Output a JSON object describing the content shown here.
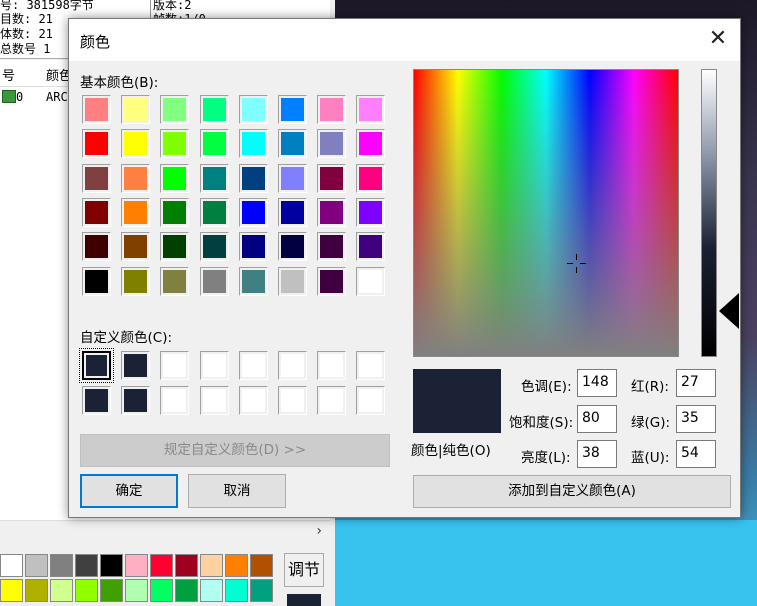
{
  "background": {
    "info_lines": [
      "号: 381598字节",
      "目数: 21",
      "体数: 21",
      "总数号 1"
    ],
    "info_right": [
      "版本:2",
      "帧数:1/0"
    ],
    "list_headers": [
      "号",
      "颜色"
    ],
    "list_row": {
      "index": "0",
      "value": "ARC"
    },
    "scroll_arrow": "›",
    "palette_colors": [
      "#ffffff",
      "#c0c0c0",
      "#808080",
      "#404040",
      "#000000",
      "#ffb0c0",
      "#ff0030",
      "#a00020",
      "#ffd0a0",
      "#ff8000",
      "#b05000",
      "#ffff00",
      "#b0b000",
      "#d0ff90",
      "#90ff00",
      "#40a000",
      "#b0ffb0",
      "#00ff60",
      "#00a040",
      "#b0fff0",
      "#00ffd0",
      "#00a080"
    ],
    "adjust_label": "调节"
  },
  "dialog": {
    "title": "颜色",
    "close_icon": "close-icon",
    "basic_colors_label": "基本颜色(B):",
    "basic_colors": [
      "#ff8080",
      "#ffff80",
      "#80ff80",
      "#00ff80",
      "#80ffff",
      "#0080ff",
      "#ff80c0",
      "#ff80ff",
      "#ff0000",
      "#ffff00",
      "#80ff00",
      "#00ff40",
      "#00ffff",
      "#0080c0",
      "#8080c0",
      "#ff00ff",
      "#804040",
      "#ff8040",
      "#00ff00",
      "#008080",
      "#004080",
      "#8080ff",
      "#800040",
      "#ff0080",
      "#800000",
      "#ff8000",
      "#008000",
      "#008040",
      "#0000ff",
      "#0000a0",
      "#800080",
      "#8000ff",
      "#400000",
      "#804000",
      "#004000",
      "#004040",
      "#000080",
      "#000040",
      "#400040",
      "#400080",
      "#000000",
      "#808000",
      "#808040",
      "#808080",
      "#408080",
      "#c0c0c0",
      "#400040",
      "#ffffff"
    ],
    "custom_colors_label": "自定义颜色(C):",
    "custom_colors": [
      "#1b2235",
      "#1b2235",
      "#ffffff",
      "#ffffff",
      "#ffffff",
      "#ffffff",
      "#ffffff",
      "#ffffff",
      "#1b2235",
      "#1b2235",
      "#ffffff",
      "#ffffff",
      "#ffffff",
      "#ffffff",
      "#ffffff",
      "#ffffff"
    ],
    "define_custom_button": "规定自定义颜色(D) >>",
    "ok_button": "确定",
    "cancel_button": "取消",
    "preview_label": "颜色|纯色(O)",
    "preview_color": "#1b2235",
    "hue_label": "色调(E):",
    "hue_value": "148",
    "sat_label": "饱和度(S):",
    "sat_value": "80",
    "lum_label": "亮度(L):",
    "lum_value": "38",
    "red_label": "红(R):",
    "red_value": "27",
    "green_label": "绿(G):",
    "green_value": "35",
    "blue_label": "蓝(U):",
    "blue_value": "54",
    "add_custom_button": "添加到自定义颜色(A)"
  }
}
